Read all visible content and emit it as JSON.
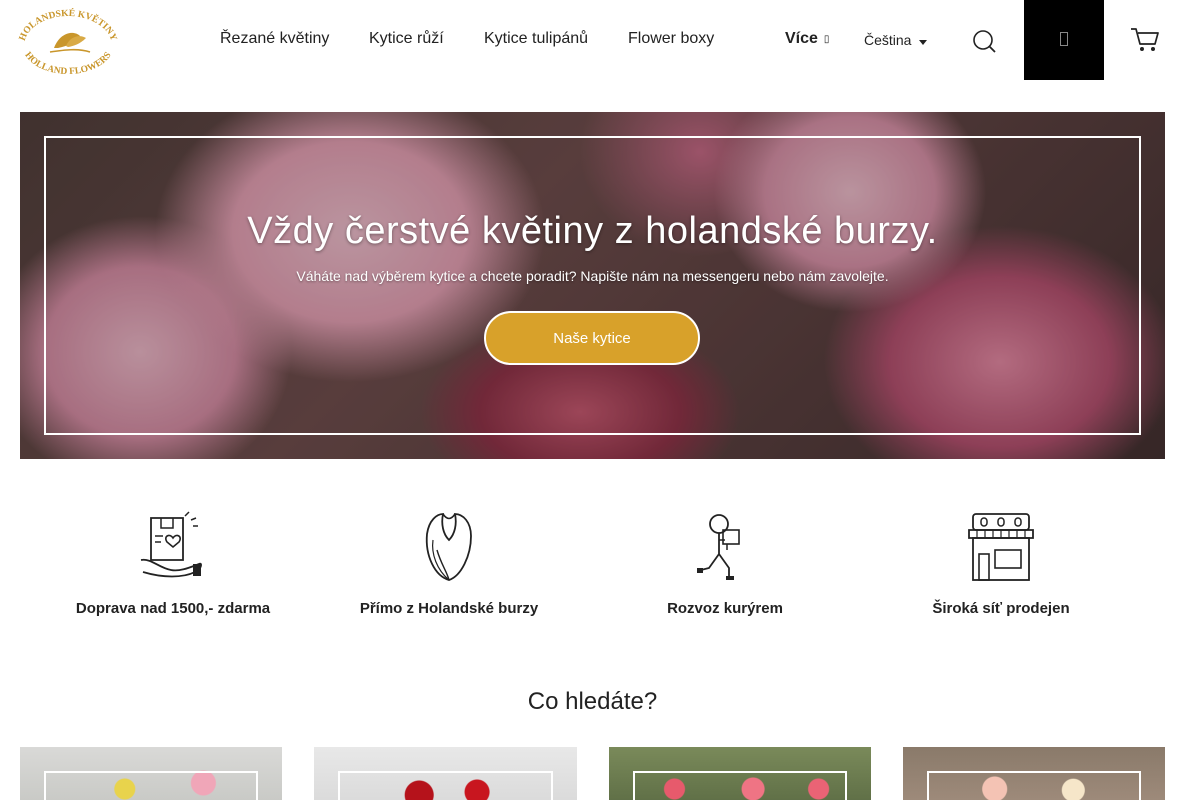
{
  "brand": {
    "logo_top": "HOLANDSKÉ KVĚTINY",
    "logo_bottom": "HOLLAND FLOWERS",
    "gold": "#c9962b"
  },
  "nav": {
    "items": [
      {
        "label": "Řezané květiny"
      },
      {
        "label": "Kytice růží"
      },
      {
        "label": "Kytice tulipánů"
      },
      {
        "label": "Flower boxy"
      }
    ],
    "more_label": "Více",
    "language": "Čeština"
  },
  "hero": {
    "title": "Vždy čerstvé květiny z holandské burzy.",
    "subtitle": "Váháte nad výběrem kytice a chcete poradit? Napište nám na messengeru nebo nám zavolejte.",
    "cta_label": "Naše kytice",
    "cta_color": "#d8a12a"
  },
  "features": [
    {
      "icon": "delivery-box-icon",
      "label": "Doprava nad 1500,- zdarma"
    },
    {
      "icon": "tulip-icon",
      "label": "Přímo z Holandské burzy"
    },
    {
      "icon": "courier-icon",
      "label": "Rozvoz kurýrem"
    },
    {
      "icon": "shop-icon",
      "label": "Široká síť prodejen"
    }
  ],
  "section": {
    "title": "Co hledáte?"
  },
  "icons": {
    "search": "search-icon",
    "account": "account-icon",
    "cart": "cart-icon"
  }
}
